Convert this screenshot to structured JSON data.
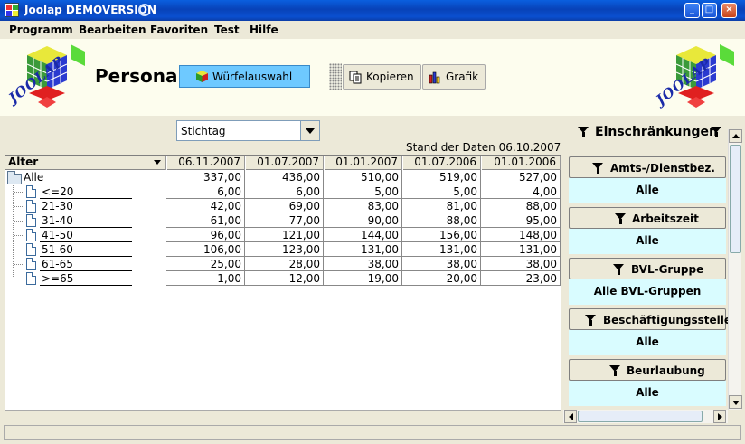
{
  "window": {
    "title": "Joolap DEMOVERSION"
  },
  "menu": [
    "Programm",
    "Bearbeiten",
    "Favoriten",
    "Test",
    "Hilfe"
  ],
  "header": {
    "logo_text": "JOOLAP",
    "page_title": "Personal",
    "cube_select_label": "Würfelauswahl",
    "copy_label": "Kopieren",
    "chart_label": "Grafik"
  },
  "date_selector": {
    "value": "Stichtag"
  },
  "data_status": "Stand der Daten 06.10.2007",
  "table": {
    "dimension_label": "Alter",
    "columns": [
      "06.11.2007",
      "01.07.2007",
      "01.01.2007",
      "01.07.2006",
      "01.01.2006"
    ],
    "rows": [
      {
        "label": "Alle",
        "values": [
          "337,00",
          "436,00",
          "510,00",
          "519,00",
          "527,00"
        ]
      },
      {
        "label": "<=20",
        "values": [
          "6,00",
          "6,00",
          "5,00",
          "5,00",
          "4,00"
        ]
      },
      {
        "label": "21-30",
        "values": [
          "42,00",
          "69,00",
          "83,00",
          "81,00",
          "88,00"
        ]
      },
      {
        "label": "31-40",
        "values": [
          "61,00",
          "77,00",
          "90,00",
          "88,00",
          "95,00"
        ]
      },
      {
        "label": "41-50",
        "values": [
          "96,00",
          "121,00",
          "144,00",
          "156,00",
          "148,00"
        ]
      },
      {
        "label": "51-60",
        "values": [
          "106,00",
          "123,00",
          "131,00",
          "131,00",
          "131,00"
        ]
      },
      {
        "label": "61-65",
        "values": [
          "25,00",
          "28,00",
          "38,00",
          "38,00",
          "38,00"
        ]
      },
      {
        "label": ">=65",
        "values": [
          "1,00",
          "12,00",
          "19,00",
          "20,00",
          "23,00"
        ]
      }
    ]
  },
  "filters": {
    "title": "Einschränkungen",
    "items": [
      {
        "name": "Amts-/Dienstbez.",
        "value": "Alle"
      },
      {
        "name": "Arbeitszeit",
        "value": "Alle"
      },
      {
        "name": "BVL-Gruppe",
        "value": "Alle BVL-Gruppen"
      },
      {
        "name": "Beschäftigungsstelle",
        "value": "Alle"
      },
      {
        "name": "Beurlaubung",
        "value": "Alle"
      }
    ]
  },
  "colors": {
    "titlebar": "#0842b8",
    "cube_button": "#6ec9ff",
    "filter_value_bg": "#d9fcff",
    "header_bg": "#fdfdee"
  }
}
